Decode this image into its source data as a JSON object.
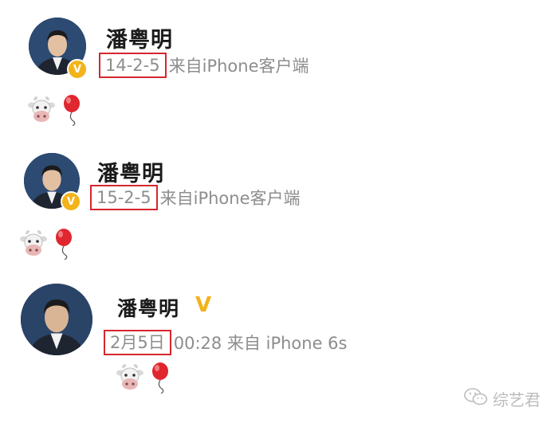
{
  "posts": [
    {
      "name": "潘粤明",
      "date": "14-2-5",
      "source": "来自iPhone客户端"
    },
    {
      "name": "潘粤明",
      "date": "15-2-5",
      "source": "来自iPhone客户端"
    },
    {
      "name": "潘粤明",
      "verified_mark": "V",
      "date": "2月5日",
      "source": "00:28 来自 iPhone 6s"
    }
  ],
  "badge_letter": "V",
  "emojis": [
    "cow-face-emoji",
    "red-balloon-emoji"
  ],
  "watermark": {
    "text": "综艺君",
    "icon": "wechat-icon"
  },
  "colors": {
    "highlight_box": "#d7262e",
    "verified": "#f3b31a",
    "meta_text": "#8d8d8d"
  }
}
